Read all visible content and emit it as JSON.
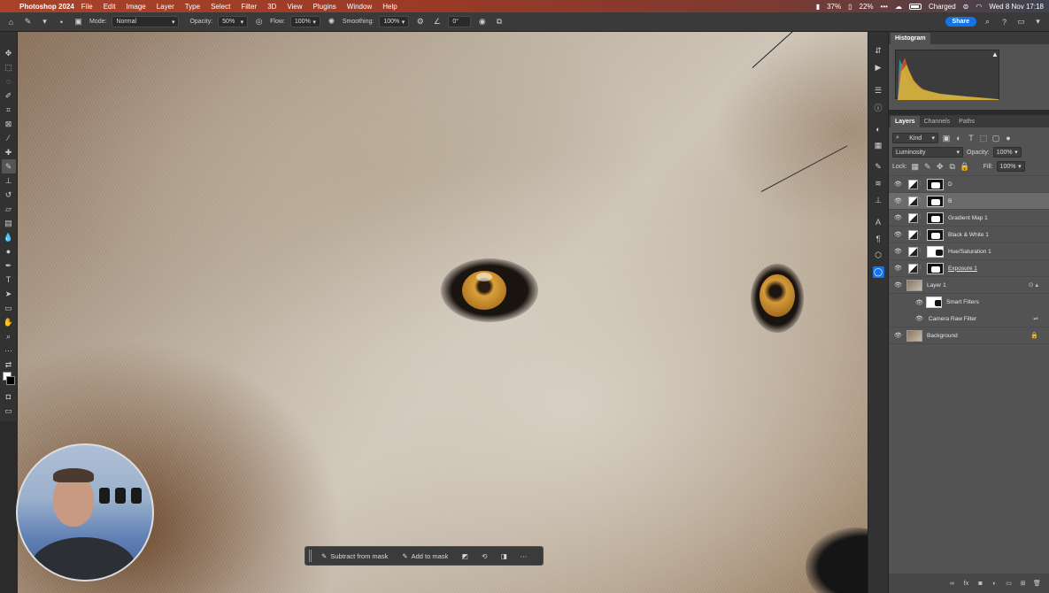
{
  "menubar": {
    "app": "Photoshop 2024",
    "items": [
      "File",
      "Edit",
      "Image",
      "Layer",
      "Type",
      "Select",
      "Filter",
      "3D",
      "View",
      "Plugins",
      "Window",
      "Help"
    ],
    "status": {
      "cpu_a": "37%",
      "cpu_b": "22%",
      "battery": "Charged",
      "datetime": "Wed 8 Nov  17:18"
    }
  },
  "options": {
    "mode_label": "Mode:",
    "mode_value": "Normal",
    "opacity_label": "Opacity:",
    "opacity_value": "50%",
    "flow_label": "Flow:",
    "flow_value": "100%",
    "smoothing_label": "Smoothing:",
    "smoothing_value": "100%",
    "angle_value": "0°",
    "share_label": "Share"
  },
  "contextbar": {
    "subtract": "Subtract from mask",
    "add": "Add to mask"
  },
  "panels": {
    "top_tab": "Histogram",
    "layer_tabs": [
      "Layers",
      "Channels",
      "Paths"
    ],
    "filter_kind": "Kind",
    "blend_mode": "Luminosity",
    "opacity_label": "Opacity:",
    "opacity_value": "100%",
    "lock_label": "Lock:",
    "fill_label": "Fill:",
    "fill_value": "100%"
  },
  "layers": [
    {
      "name": "D",
      "selected": false
    },
    {
      "name": "B",
      "selected": true
    },
    {
      "name": "Gradient Map 1",
      "selected": false
    },
    {
      "name": "Black & White 1",
      "selected": false
    },
    {
      "name": "Hue/Saturation 1",
      "selected": false
    },
    {
      "name": "Exposure 1",
      "selected": false
    },
    {
      "name": "Layer 1",
      "selected": false
    },
    {
      "name": "Smart Filters",
      "selected": false
    },
    {
      "name": "Camera Raw Filter",
      "selected": false
    },
    {
      "name": "Background",
      "selected": false
    }
  ]
}
